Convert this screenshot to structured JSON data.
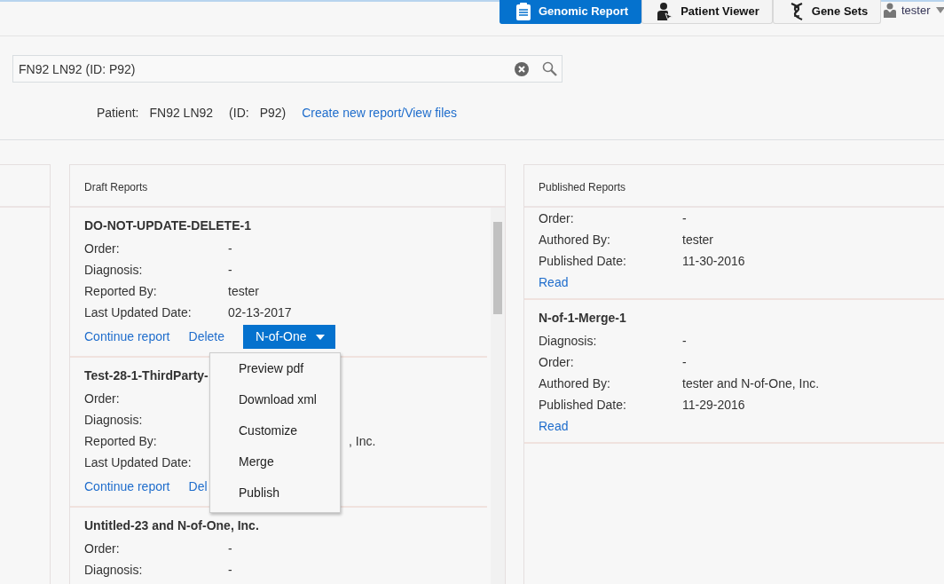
{
  "top_nav": {
    "tabs": [
      {
        "label": "Genomic Report",
        "selected": true
      },
      {
        "label": "Patient Viewer",
        "selected": false
      },
      {
        "label": "Gene Sets",
        "selected": false
      }
    ],
    "user": "tester"
  },
  "search": {
    "value": "FN92 LN92 (ID: P92)"
  },
  "patient": {
    "label": "Patient:",
    "name": "FN92 LN92",
    "id_label": "(ID:",
    "id": "P92)",
    "link": "Create new report/View files"
  },
  "draft_reports": {
    "title": "Draft Reports",
    "items": [
      {
        "title": "DO-NOT-UPDATE-DELETE-1",
        "fields": [
          {
            "label": "Order:",
            "value": "-"
          },
          {
            "label": "Diagnosis:",
            "value": "-"
          },
          {
            "label": "Reported By:",
            "value": "tester"
          },
          {
            "label": "Last Updated Date:",
            "value": "02-13-2017"
          }
        ],
        "actions": [
          "Continue report",
          "Delete"
        ],
        "menu_button": "N-of-One"
      },
      {
        "title": "Test-28-1-ThirdParty-",
        "fields": [
          {
            "label": "Order:"
          },
          {
            "label": "Diagnosis:"
          },
          {
            "label": "Reported By:",
            "value": ", Inc.",
            "covered": true
          },
          {
            "label": "Last Updated Date:"
          }
        ],
        "actions": [
          "Continue report",
          "Del"
        ]
      },
      {
        "title": "Untitled-23 and N-of-One, Inc.",
        "fields": [
          {
            "label": "Order:",
            "value": "-"
          },
          {
            "label": "Diagnosis:",
            "value": "-"
          }
        ]
      }
    ],
    "menu": {
      "items": [
        "Preview pdf",
        "Download xml",
        "Customize",
        "Merge",
        "Publish"
      ]
    }
  },
  "published_reports": {
    "title": "Published Reports",
    "items": [
      {
        "fields": [
          {
            "label": "Order:",
            "value": "-"
          },
          {
            "label": "Authored By:",
            "value": "tester"
          },
          {
            "label": "Published Date:",
            "value": "11-30-2016"
          }
        ],
        "action": "Read"
      },
      {
        "title": "N-of-1-Merge-1",
        "fields": [
          {
            "label": "Diagnosis:",
            "value": "-"
          },
          {
            "label": "Order:",
            "value": "-"
          },
          {
            "label": "Authored By:",
            "value": "tester and N-of-One, Inc."
          },
          {
            "label": "Published Date:",
            "value": "11-29-2016"
          }
        ],
        "action": "Read"
      }
    ]
  }
}
